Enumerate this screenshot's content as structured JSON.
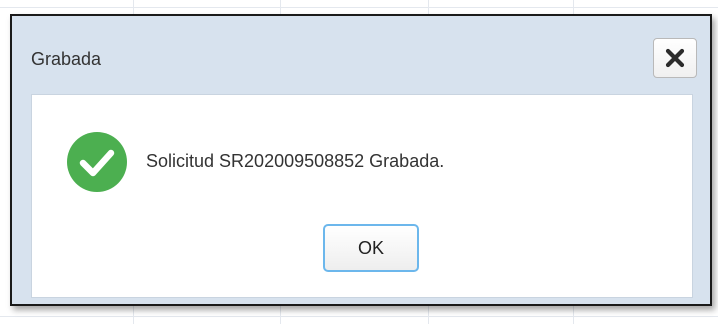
{
  "dialog": {
    "title": "Grabada",
    "close_icon": "close-icon",
    "success_icon": "check-circle-icon",
    "message": "Solicitud SR202009508852 Grabada.",
    "ok_label": "OK"
  },
  "colors": {
    "titlebar_bg": "#d7e2ee",
    "success_green": "#4caf50",
    "ok_focus_border": "#6cb7ec"
  }
}
